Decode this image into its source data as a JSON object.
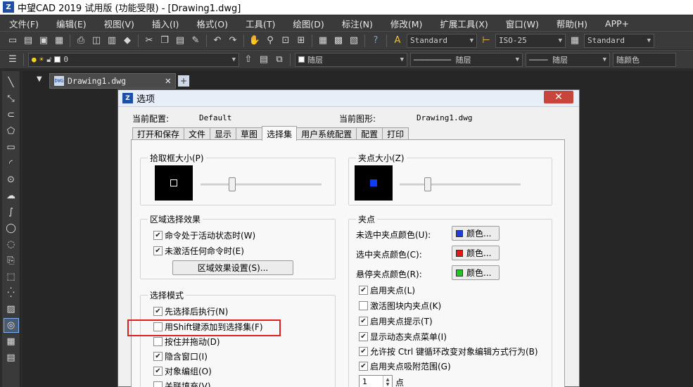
{
  "window": {
    "title": "中望CAD 2019 试用版 (功能受限) - [Drawing1.dwg]"
  },
  "menu": [
    "文件(F)",
    "编辑(E)",
    "视图(V)",
    "插入(I)",
    "格式(O)",
    "工具(T)",
    "绘图(D)",
    "标注(N)",
    "修改(M)",
    "扩展工具(X)",
    "窗口(W)",
    "帮助(H)",
    "APP+"
  ],
  "toolbar1": {
    "text_style": "Standard",
    "dim_style": "ISO-25",
    "table_style": "Standard"
  },
  "toolbar2": {
    "layer": "0",
    "color": "随层",
    "linetype": "随层",
    "lineweight": "随层",
    "plotstyle": "随颜色"
  },
  "document": {
    "tab_name": "Drawing1.dwg",
    "icon_text": "DWG"
  },
  "dialog": {
    "title": "选项",
    "current_profile_label": "当前配置:",
    "current_profile_value": "Default",
    "current_drawing_label": "当前图形:",
    "current_drawing_value": "Drawing1.dwg",
    "tabs": [
      "打开和保存",
      "文件",
      "显示",
      "草图",
      "选择集",
      "用户系统配置",
      "配置",
      "打印"
    ],
    "pickbox": {
      "label": "拾取框大小(P)",
      "level": 0.26
    },
    "gripsize": {
      "label": "夹点大小(Z)",
      "level": 0.23
    },
    "region_effect": {
      "label": "区域选择效果",
      "items": [
        {
          "label": "命令处于活动状态时(W)",
          "checked": true
        },
        {
          "label": "未激活任何命令时(E)",
          "checked": true
        }
      ],
      "settings_button": "区域效果设置(S)..."
    },
    "selection_mode": {
      "label": "选择模式",
      "items": [
        {
          "label": "先选择后执行(N)",
          "checked": true
        },
        {
          "label": "用Shift键添加到选择集(F)",
          "checked": false
        },
        {
          "label": "按住并拖动(D)",
          "checked": false
        },
        {
          "label": "隐含窗口(I)",
          "checked": true
        },
        {
          "label": "对象编组(O)",
          "checked": true
        },
        {
          "label": "关联填充(V)",
          "checked": false
        }
      ]
    },
    "grips": {
      "label": "夹点",
      "colors": [
        {
          "label": "未选中夹点颜色(U):",
          "button": "颜色...",
          "color": "#1a3ee0"
        },
        {
          "label": "选中夹点颜色(C):",
          "button": "颜色...",
          "color": "#e01818"
        },
        {
          "label": "悬停夹点颜色(R):",
          "button": "颜色...",
          "color": "#1ec81e"
        }
      ],
      "items": [
        {
          "label": "启用夹点(L)",
          "checked": true
        },
        {
          "label": "激活图块内夹点(K)",
          "checked": false
        },
        {
          "label": "启用夹点提示(T)",
          "checked": true
        },
        {
          "label": "显示动态夹点菜单(I)",
          "checked": true
        },
        {
          "label": "允许按 Ctrl 键循环改变对象编辑方式行为(B)",
          "checked": true
        },
        {
          "label": "启用夹点吸附范围(G)",
          "checked": true
        }
      ],
      "snap_value": "1",
      "snap_unit": "点"
    }
  }
}
